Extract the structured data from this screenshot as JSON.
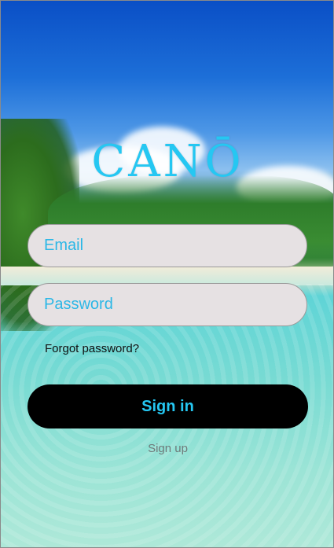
{
  "app": {
    "logo_text": "CANŌ"
  },
  "form": {
    "email_placeholder": "Email",
    "password_placeholder": "Password",
    "forgot_label": "Forgot password?",
    "signin_label": "Sign in",
    "signup_label": "Sign up"
  },
  "colors": {
    "accent": "#25c7f2",
    "button_bg": "#000000",
    "field_bg": "#e6e1e3"
  }
}
